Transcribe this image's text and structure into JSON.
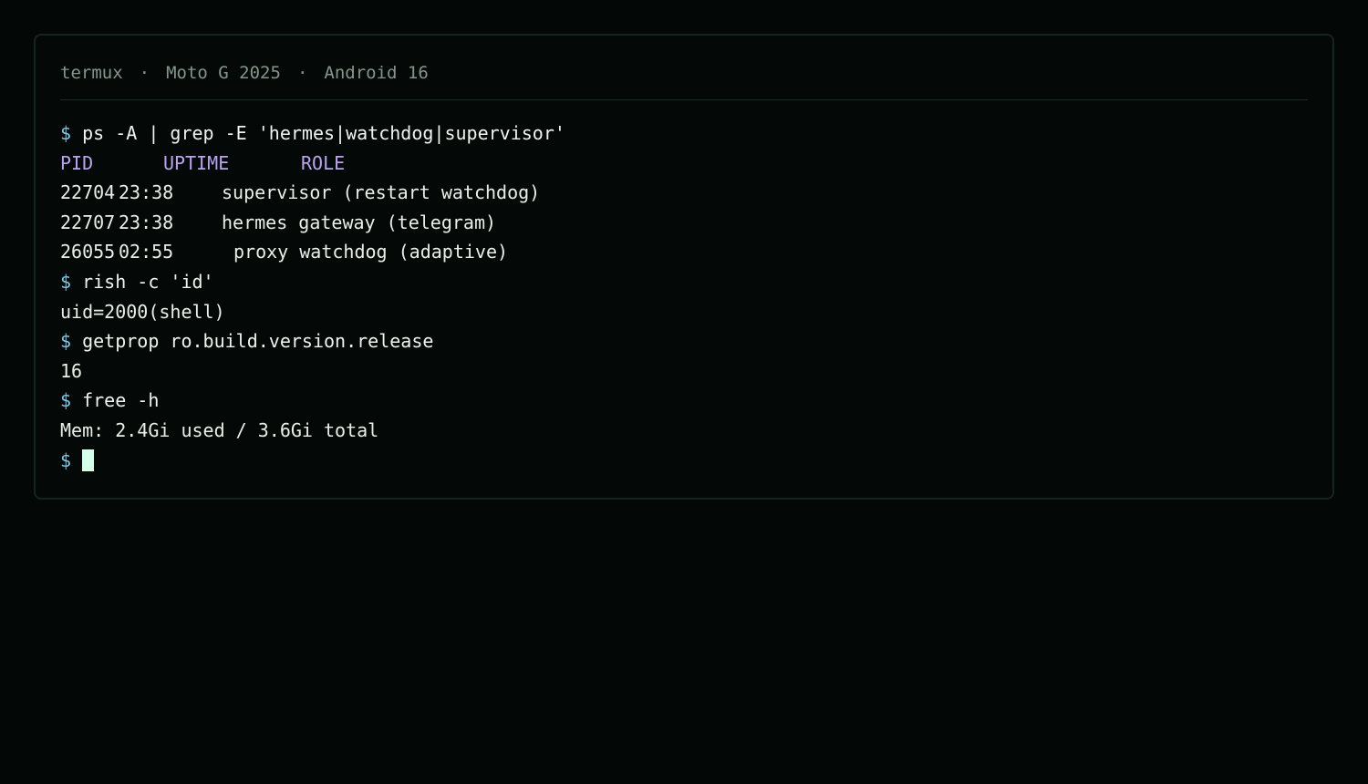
{
  "header": {
    "app": "termux",
    "separator": "·",
    "device": "Moto G 2025",
    "os": "Android 16"
  },
  "prompt_symbol": "$",
  "commands": {
    "ps": "ps -A | grep -E 'hermes|watchdog|supervisor'",
    "id": "rish -c 'id'",
    "getprop": "getprop ro.build.version.release",
    "free": "free -h"
  },
  "process_table": {
    "columns": [
      "PID",
      "UPTIME",
      "ROLE"
    ],
    "rows": [
      {
        "pid": "22704",
        "uptime": "23:38",
        "role": "supervisor (restart watchdog)"
      },
      {
        "pid": "22707",
        "uptime": "23:38",
        "role": "hermes gateway (telegram)"
      },
      {
        "pid": "26055",
        "uptime": "02:55",
        "role": "proxy watchdog (adaptive)"
      }
    ]
  },
  "outputs": {
    "id": "uid=2000(shell)",
    "getprop": "16",
    "free": "Mem: 2.4Gi used / 3.6Gi total"
  },
  "colors": {
    "background": "#030806",
    "prompt": "#7cc7e6",
    "table_header": "#b9a5ef",
    "text": "#e8efe9",
    "cursor": "#d4ffe8"
  }
}
